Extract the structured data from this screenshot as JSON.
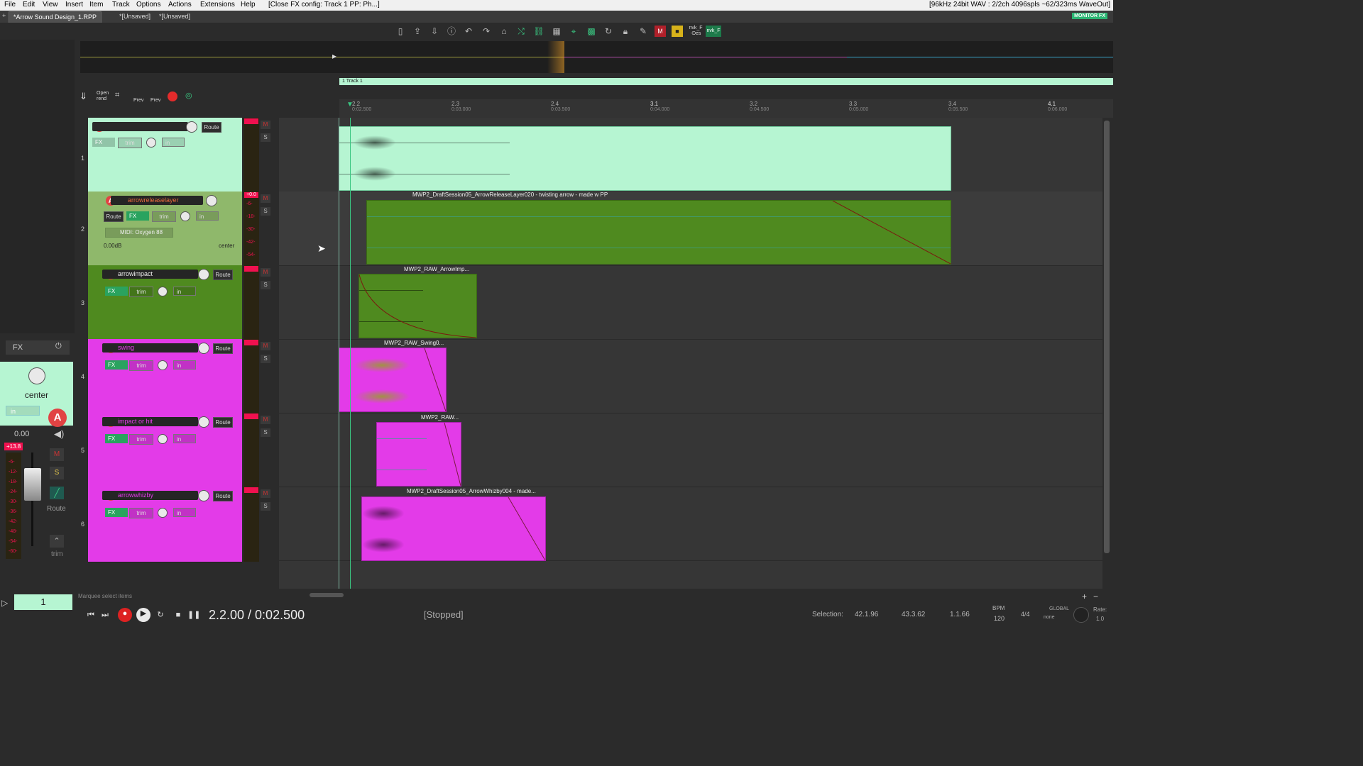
{
  "menubar": {
    "items": [
      "File",
      "Edit",
      "View",
      "Insert",
      "Item",
      "Track",
      "Options",
      "Actions",
      "Extensions",
      "Help"
    ],
    "status": "[Close FX config: Track 1 PP: Ph...]",
    "audio_info": "[96kHz 24bit WAV : 2/2ch 4096spls ~62/323ms WaveOut]"
  },
  "tabs": [
    {
      "label": "*Arrow Sound Design_1.RPP"
    },
    {
      "label": "*[Unsaved]"
    },
    {
      "label": "*[Unsaved]"
    }
  ],
  "monitor_fx": "MONITOR FX",
  "toolbar": {
    "nvk_label_1": "nvk_F\n-Des",
    "nvk_label_2": "nvk_F"
  },
  "tcp_bar": {
    "open_rend": "Open\nrend",
    "prev1": "Prev",
    "prev2": "Prev"
  },
  "track1_label": "1 Track 1",
  "ruler": [
    {
      "bar": "2.2",
      "time": "0:02.500"
    },
    {
      "bar": "2.3",
      "time": "0:03.000"
    },
    {
      "bar": "2.4",
      "time": "0:03.500"
    },
    {
      "bar": "3.1",
      "time": "0:04.000"
    },
    {
      "bar": "3.2",
      "time": "0:04.500"
    },
    {
      "bar": "3.3",
      "time": "0:05.000"
    },
    {
      "bar": "3.4",
      "time": "0:05.500"
    },
    {
      "bar": "4.1",
      "time": "0:06.000"
    }
  ],
  "tracks": [
    {
      "num": "1",
      "name": "",
      "color": "#b6f5d2",
      "route": "Route",
      "fx": "FX",
      "trim": "trim",
      "in": "in"
    },
    {
      "num": "2",
      "name": "arrowreleaselayer",
      "color": "#8fb86b",
      "route": "Route",
      "fx": "FX",
      "trim": "trim",
      "in": "in",
      "midi": "MIDI: Oxygen 88",
      "vol": "0.00dB",
      "pan": "center",
      "meter_peak": "+0.0",
      "meter_ticks": [
        "-6-",
        "-18-",
        "-30-",
        "-42-",
        "-54-"
      ]
    },
    {
      "num": "3",
      "name": "arrowimpact",
      "color": "#4f8a1f",
      "route": "Route",
      "fx": "FX",
      "trim": "trim",
      "in": "in"
    },
    {
      "num": "4",
      "name": "swing",
      "color": "#e33be8",
      "route": "Route",
      "fx": "FX",
      "trim": "trim",
      "in": "in"
    },
    {
      "num": "5",
      "name": "impact or hit",
      "color": "#e33be8",
      "route": "Route",
      "fx": "FX",
      "trim": "trim",
      "in": "in"
    },
    {
      "num": "6",
      "name": "arrowwhizby",
      "color": "#e33be8",
      "route": "Route",
      "fx": "FX",
      "trim": "trim",
      "in": "in"
    }
  ],
  "items": [
    {
      "label": "",
      "color": "#b6f5d2"
    },
    {
      "label": "MWP2_DraftSession05_ArrowReleaseLayer020 - twisting arrow - made w PP",
      "color": "#4f8a1f"
    },
    {
      "label": "MWP2_RAW_ArrowImp...",
      "color": "#4f8a1f"
    },
    {
      "label": "MWP2_RAW_Swing0...",
      "color": "#e33be8"
    },
    {
      "label": "MWP2_RAW...",
      "color": "#e33be8"
    },
    {
      "label": "MWP2_DraftSession05_ArrowWhizby004 - made...",
      "color": "#e33be8"
    }
  ],
  "mixer": {
    "fx": "FX",
    "pan": "center",
    "in": "in",
    "vol": "0.00",
    "peak": "+13.8",
    "ticks": [
      "-6-",
      "-12-",
      "-18-",
      "-24-",
      "-30-",
      "-36-",
      "-42-",
      "-48-",
      "-54-",
      "-60-"
    ],
    "m": "M",
    "s": "S",
    "route": "Route",
    "trim": "trim",
    "track_num": "1"
  },
  "transport": {
    "status_hint": "Marquee select items",
    "position": "2.2.00 / 0:02.500",
    "state": "[Stopped]",
    "selection_label": "Selection:",
    "sel_start": "42.1.96",
    "sel_end": "43.3.62",
    "sel_len": "1.1.66",
    "bpm_label": "BPM",
    "bpm": "120",
    "timesig": "4/4",
    "global": "GLOBAL",
    "none": "none",
    "rate_label": "Rate:",
    "rate": "1.0"
  }
}
